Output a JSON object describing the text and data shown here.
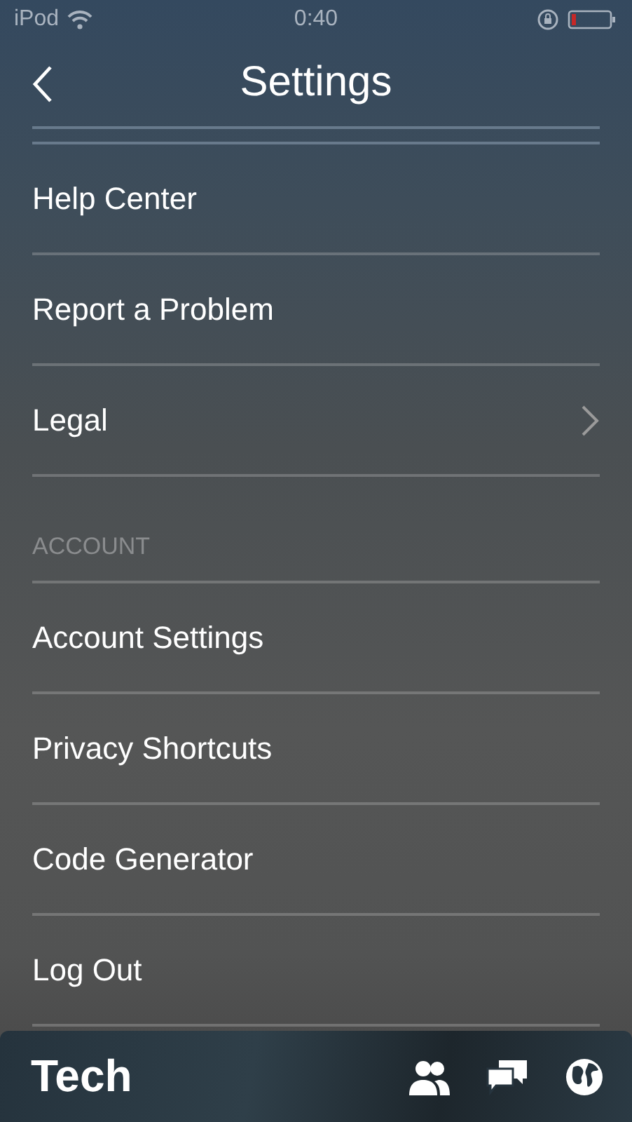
{
  "status_bar": {
    "carrier": "iPod",
    "time": "0:40"
  },
  "nav": {
    "title": "Settings"
  },
  "sections": [
    {
      "items": [
        {
          "label": "Help Center",
          "kind": "plain"
        },
        {
          "label": "Report a Problem",
          "kind": "plain"
        },
        {
          "label": "Legal",
          "kind": "disclosure"
        }
      ]
    },
    {
      "header": "ACCOUNT",
      "items": [
        {
          "label": "Account Settings",
          "kind": "plain"
        },
        {
          "label": "Privacy Shortcuts",
          "kind": "plain"
        },
        {
          "label": "Code Generator",
          "kind": "plain"
        },
        {
          "label": "Log Out",
          "kind": "plain"
        }
      ]
    }
  ],
  "bottom_bar": {
    "title": "Tech"
  }
}
